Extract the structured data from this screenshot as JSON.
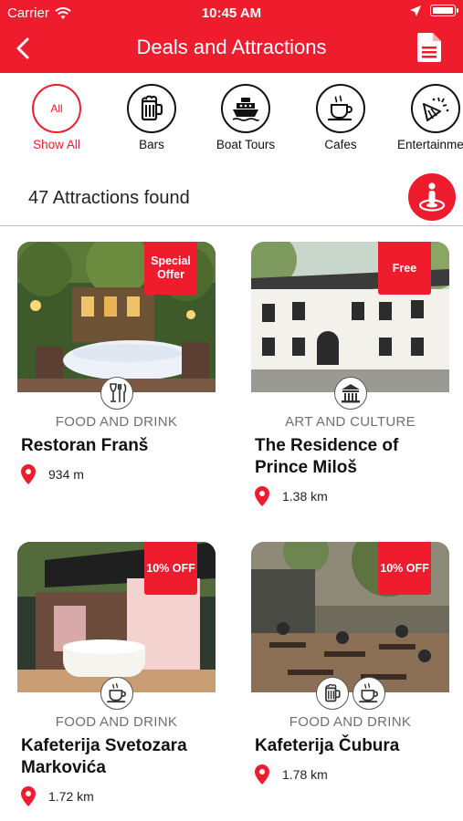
{
  "status": {
    "carrier": "Carrier",
    "time": "10:45 AM"
  },
  "header": {
    "title": "Deals and Attractions"
  },
  "categories": [
    {
      "label": "Show All",
      "short": "All",
      "icon": "all",
      "active": true
    },
    {
      "label": "Bars",
      "icon": "beer-mug-icon"
    },
    {
      "label": "Boat Tours",
      "icon": "boat-icon"
    },
    {
      "label": "Cafes",
      "icon": "coffee-cup-icon"
    },
    {
      "label": "Entertainment",
      "icon": "party-popper-icon"
    }
  ],
  "results": {
    "count_text": "47 Attractions found"
  },
  "cards": [
    {
      "badge": "Special Offer",
      "category": "FOOD AND DRINK",
      "name": "Restoran Franš",
      "distance": "934 m",
      "icons": [
        "wine-cutlery-icon"
      ]
    },
    {
      "badge": "Free",
      "category": "ART AND CULTURE",
      "name": "The Residence of Prince Miloš",
      "distance": "1.38 km",
      "icons": [
        "museum-icon"
      ]
    },
    {
      "badge": "10% OFF",
      "category": "FOOD AND DRINK",
      "name": "Kafeterija Svetozara Markovića",
      "distance": "1.72 km",
      "icons": [
        "coffee-cup-icon"
      ]
    },
    {
      "badge": "10% OFF",
      "category": "FOOD AND DRINK",
      "name": "Kafeterija Čubura",
      "distance": "1.78 km",
      "icons": [
        "beer-mug-icon",
        "coffee-cup-icon"
      ]
    }
  ],
  "colors": {
    "brand_red": "#ee1c2d"
  }
}
